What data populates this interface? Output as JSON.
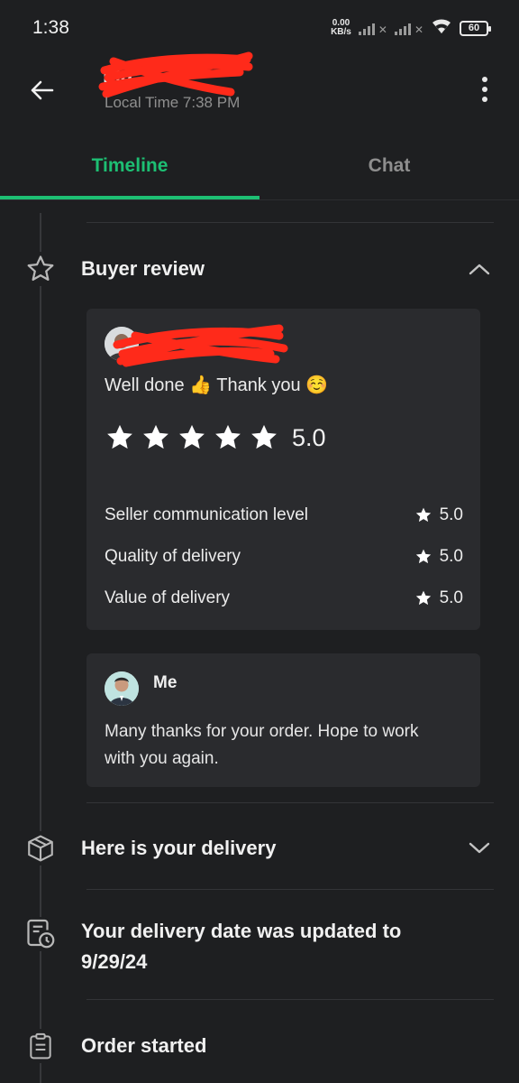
{
  "status_bar": {
    "time": "1:38",
    "net_speed_value": "0.00",
    "net_speed_unit": "KB/s",
    "battery": "60"
  },
  "header": {
    "contact_name": "Ma",
    "local_time": "Local Time 7:38 PM"
  },
  "tabs": [
    {
      "label": "Timeline",
      "active": true
    },
    {
      "label": "Chat",
      "active": false
    }
  ],
  "buyer_review": {
    "title": "Buyer review",
    "reviewer_name": "",
    "comment": "Well done 👍 Thank you ☺️",
    "overall_rating": "5.0",
    "star_count": 5,
    "criteria": [
      {
        "label": "Seller communication level",
        "value": "5.0"
      },
      {
        "label": "Quality of delivery",
        "value": "5.0"
      },
      {
        "label": "Value of delivery",
        "value": "5.0"
      }
    ]
  },
  "seller_reply": {
    "name": "Me",
    "text": "Many thanks for your order. Hope to work with you again."
  },
  "timeline_items": [
    {
      "title": "Here is your delivery",
      "icon": "box-icon"
    },
    {
      "title": "Your delivery date was updated to 9/29/24",
      "icon": "calendar-clock-icon"
    },
    {
      "title": "Order started",
      "icon": "clipboard-icon"
    }
  ],
  "colors": {
    "accent": "#1dbf73",
    "background": "#1e1f21",
    "card": "#2a2b2e",
    "redaction": "#ff2a1a"
  }
}
